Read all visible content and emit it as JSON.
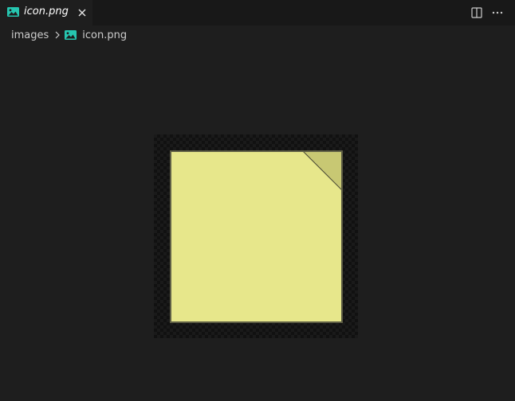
{
  "tab": {
    "label": "icon.png",
    "icon": "image-file-icon",
    "close_icon": "close-icon"
  },
  "actions": {
    "split_icon": "split-editor-icon",
    "more_icon": "more-actions-icon"
  },
  "breadcrumb": {
    "folder": "images",
    "file": "icon.png",
    "separator_icon": "chevron-right-icon",
    "file_icon": "image-file-icon"
  },
  "colors": {
    "note_fill": "#e7e78b",
    "note_fold": "#c8c873",
    "note_border": "#5e5e45",
    "image_icon": "#26c6b0"
  }
}
